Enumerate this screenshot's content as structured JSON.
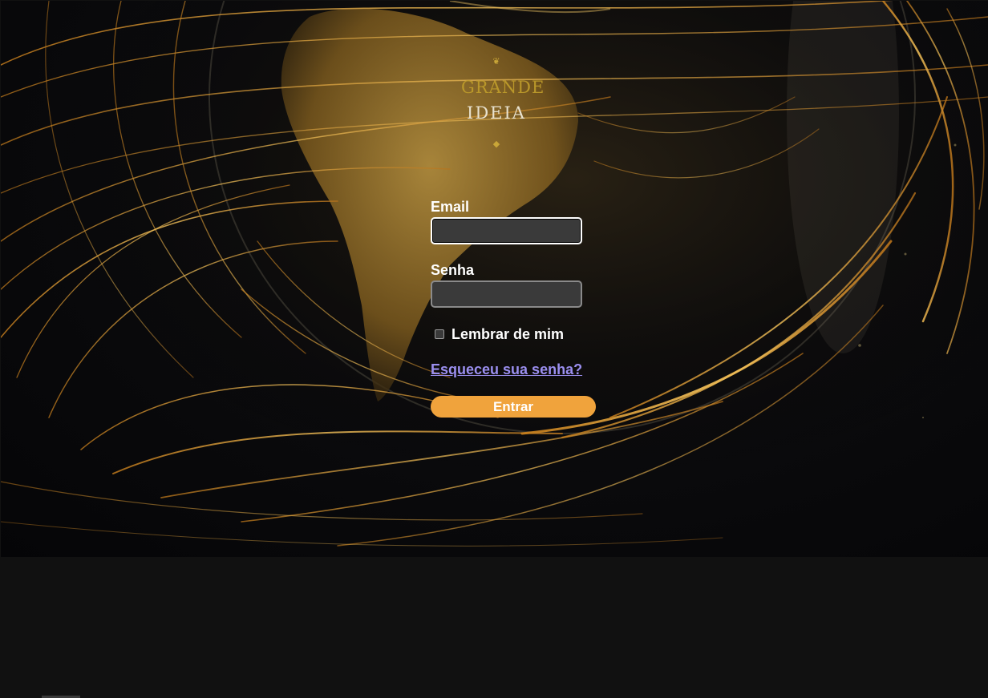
{
  "logo": {
    "word1": "GRANDE",
    "word2": "IDEIA",
    "ornament_top": "❦",
    "ornament_bottom": "◆"
  },
  "form": {
    "email_label": "Email",
    "email_value": "",
    "password_label": "Senha",
    "password_value": "",
    "remember_label": "Lembrar de mim",
    "remember_checked": false,
    "forgot_link": "Esqueceu sua senha?",
    "submit_label": "Entrar"
  },
  "colors": {
    "background": "#111111",
    "accent_button": "#f0a33c",
    "link": "#9b8ff0",
    "logo_gold": "#b9972a",
    "input_bg": "#3a3a3a"
  },
  "icons": {
    "background_art": "globe-with-golden-lines"
  }
}
